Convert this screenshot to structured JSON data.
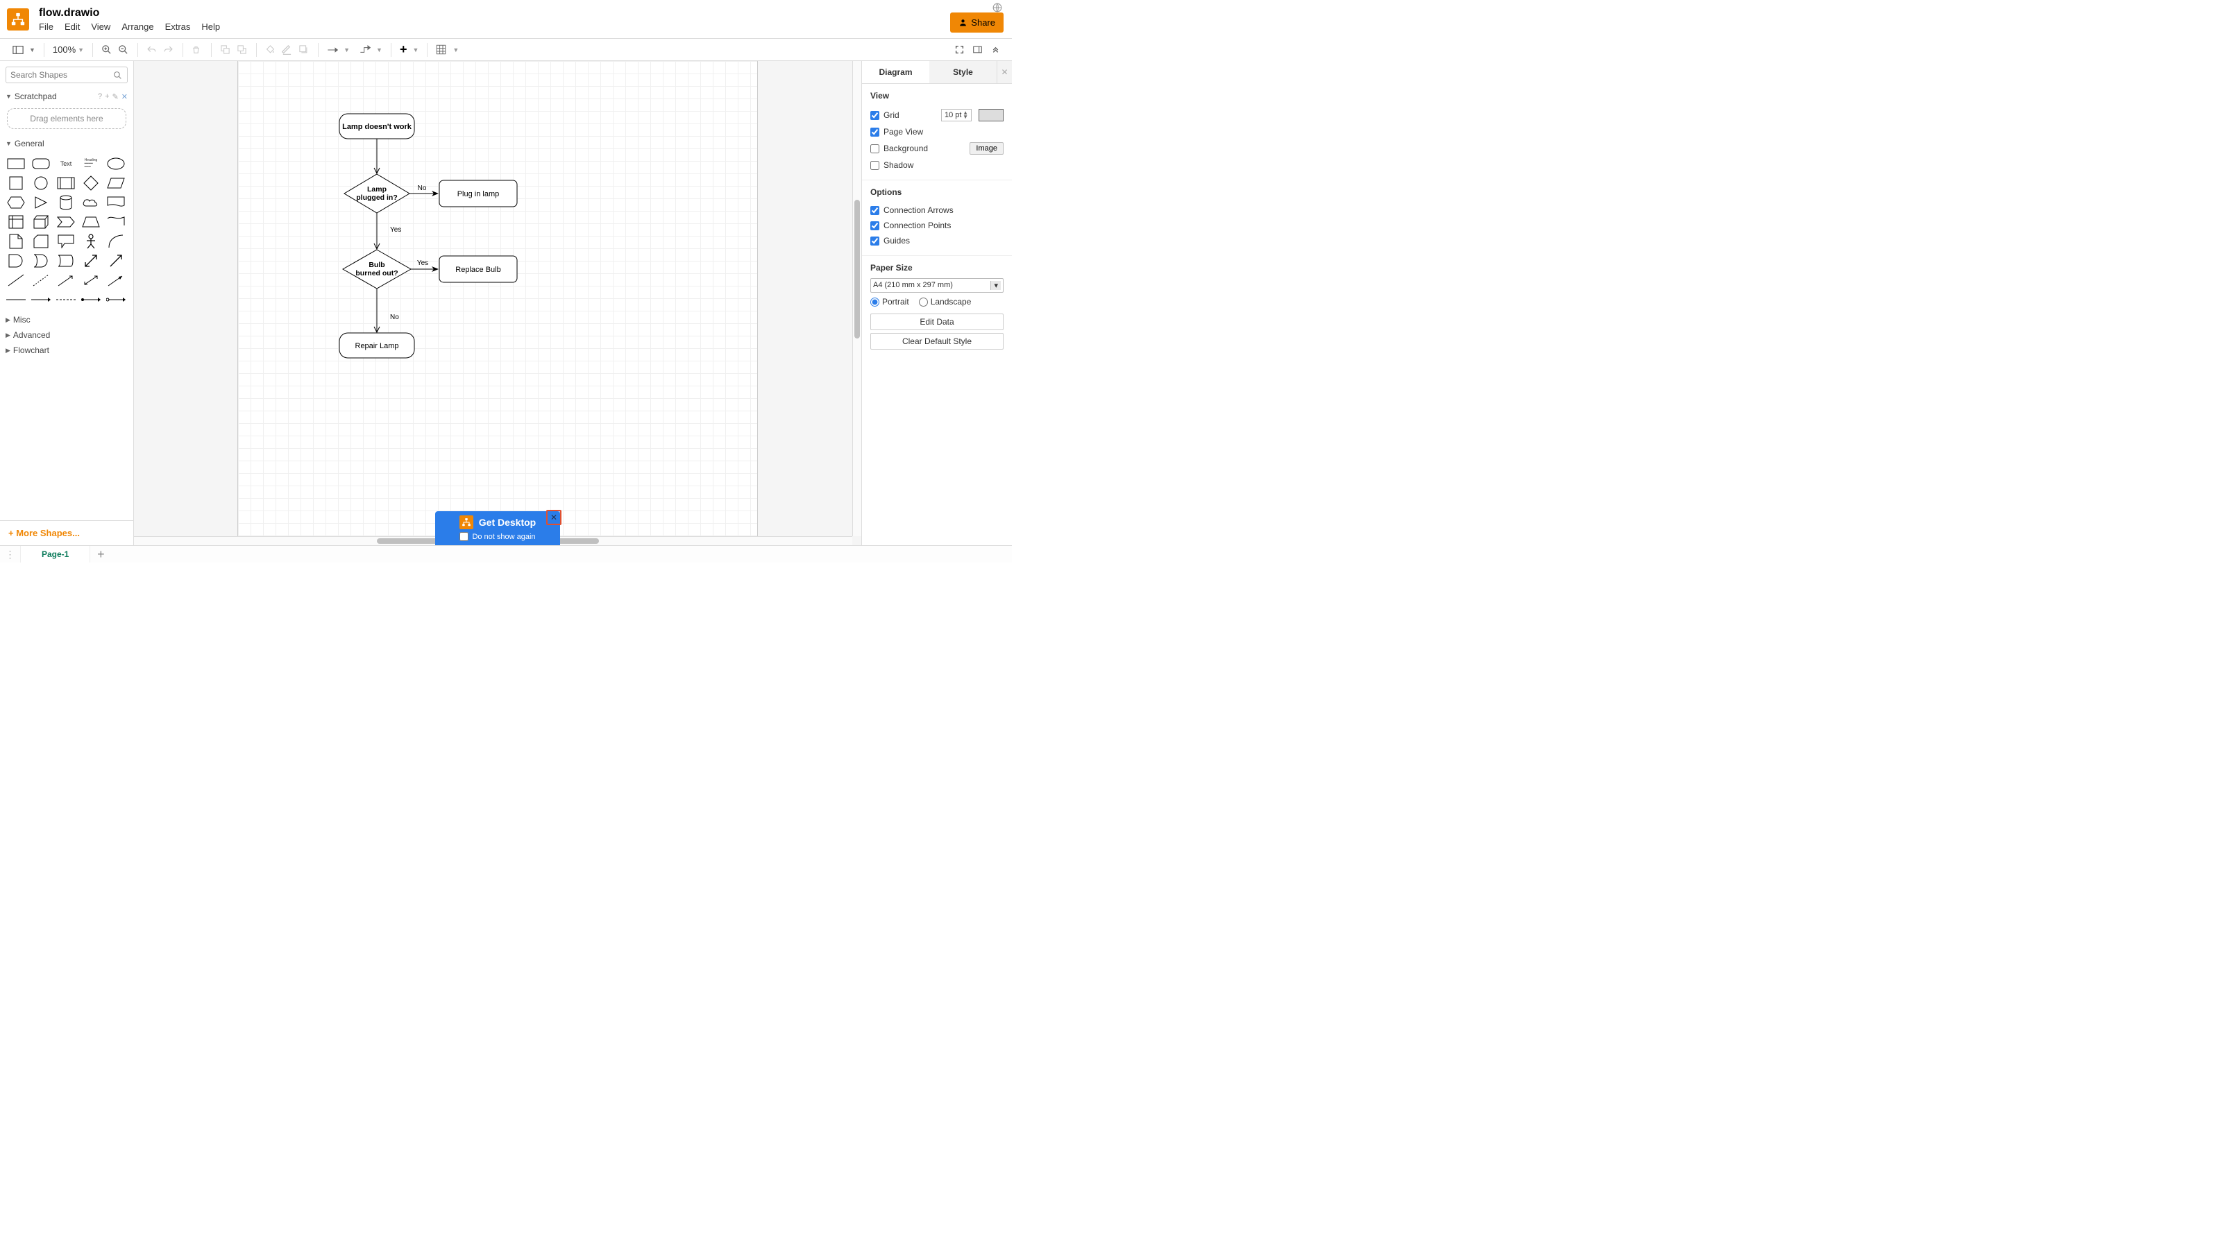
{
  "header": {
    "file_title": "flow.drawio",
    "menus": [
      "File",
      "Edit",
      "View",
      "Arrange",
      "Extras",
      "Help"
    ],
    "share_label": "Share"
  },
  "toolbar": {
    "zoom": "100%"
  },
  "sidebar": {
    "search_placeholder": "Search Shapes",
    "scratchpad_label": "Scratchpad",
    "scratchpad_drop": "Drag elements here",
    "general_label": "General",
    "misc_label": "Misc",
    "advanced_label": "Advanced",
    "flowchart_label": "Flowchart",
    "more_shapes": "More Shapes...",
    "text_label": "Text",
    "heading_label": "Heading"
  },
  "flow": {
    "n1": "Lamp doesn't work",
    "n2_l1": "Lamp",
    "n2_l2": "plugged in?",
    "n3": "Plug in lamp",
    "n4_l1": "Bulb",
    "n4_l2": "burned out?",
    "n5": "Replace Bulb",
    "n6": "Repair Lamp",
    "e_no": "No",
    "e_yes": "Yes"
  },
  "right": {
    "tab_diagram": "Diagram",
    "tab_style": "Style",
    "view_label": "View",
    "grid": "Grid",
    "grid_value": "10 pt",
    "page_view": "Page View",
    "background": "Background",
    "image_btn": "Image",
    "shadow": "Shadow",
    "options_label": "Options",
    "conn_arrows": "Connection Arrows",
    "conn_points": "Connection Points",
    "guides": "Guides",
    "paper_size_label": "Paper Size",
    "paper_size_value": "A4 (210 mm x 297 mm)",
    "portrait": "Portrait",
    "landscape": "Landscape",
    "edit_data": "Edit Data",
    "clear_style": "Clear Default Style"
  },
  "footer": {
    "page_tab": "Page-1"
  },
  "promo": {
    "title": "Get Desktop",
    "checkbox": "Do not show again"
  },
  "chart_data": {
    "type": "flowchart",
    "nodes": [
      {
        "id": "n1",
        "type": "terminator",
        "label": "Lamp doesn't work"
      },
      {
        "id": "n2",
        "type": "decision",
        "label": "Lamp plugged in?"
      },
      {
        "id": "n3",
        "type": "process",
        "label": "Plug in lamp"
      },
      {
        "id": "n4",
        "type": "decision",
        "label": "Bulb burned out?"
      },
      {
        "id": "n5",
        "type": "process",
        "label": "Replace Bulb"
      },
      {
        "id": "n6",
        "type": "terminator",
        "label": "Repair Lamp"
      }
    ],
    "edges": [
      {
        "from": "n1",
        "to": "n2",
        "label": ""
      },
      {
        "from": "n2",
        "to": "n3",
        "label": "No"
      },
      {
        "from": "n2",
        "to": "n4",
        "label": "Yes"
      },
      {
        "from": "n4",
        "to": "n5",
        "label": "Yes"
      },
      {
        "from": "n4",
        "to": "n6",
        "label": "No"
      }
    ]
  }
}
